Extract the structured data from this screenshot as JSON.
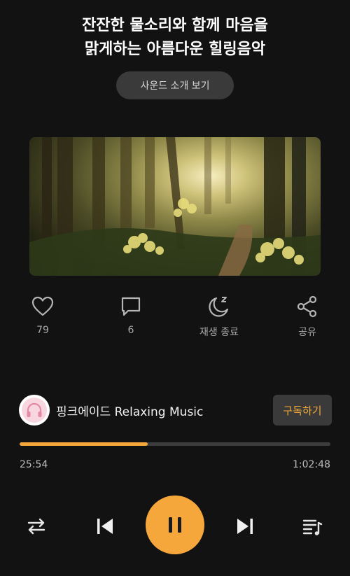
{
  "header": {
    "title_line1": "잔잔한 물소리와 함께 마음을",
    "title_line2": "맑게하는 아름다운 힐링음악",
    "intro_button": "사운드 소개 보기"
  },
  "actions": {
    "like_count": "79",
    "comment_count": "6",
    "sleep_timer_label": "재생 종료",
    "share_label": "공유"
  },
  "channel": {
    "name": "핑크에이드 Relaxing Music",
    "subscribe_label": "구독하기"
  },
  "player": {
    "current_time": "25:54",
    "total_time": "1:02:48",
    "progress_fraction": 0.412
  },
  "colors": {
    "accent": "#f6a73c",
    "background": "#121212",
    "button_bg": "#3a3a3a"
  },
  "icons": {
    "like": "heart-icon",
    "comment": "comment-icon",
    "sleep": "moon-zz-icon",
    "share": "share-icon",
    "repeat": "repeat-icon",
    "previous": "skip-previous-icon",
    "pause": "pause-icon",
    "next": "skip-next-icon",
    "playlist": "playlist-icon"
  }
}
